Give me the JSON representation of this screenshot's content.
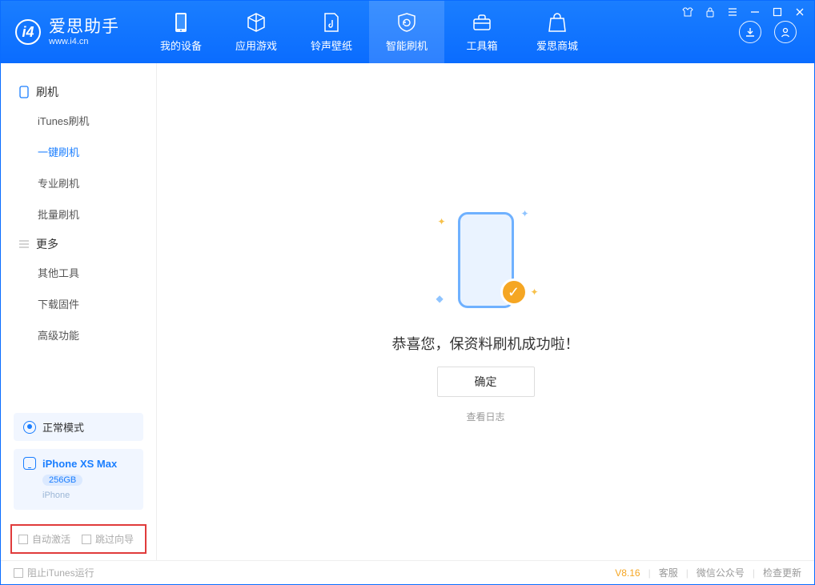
{
  "app": {
    "title": "爱思助手",
    "site": "www.i4.cn"
  },
  "nav": {
    "items": [
      {
        "label": "我的设备"
      },
      {
        "label": "应用游戏"
      },
      {
        "label": "铃声壁纸"
      },
      {
        "label": "智能刷机"
      },
      {
        "label": "工具箱"
      },
      {
        "label": "爱思商城"
      }
    ]
  },
  "sidebar": {
    "group1": {
      "title": "刷机",
      "items": [
        "iTunes刷机",
        "一键刷机",
        "专业刷机",
        "批量刷机"
      ]
    },
    "group2": {
      "title": "更多",
      "items": [
        "其他工具",
        "下载固件",
        "高级功能"
      ]
    }
  },
  "mode": {
    "label": "正常模式"
  },
  "device": {
    "name": "iPhone XS Max",
    "capacity": "256GB",
    "type": "iPhone"
  },
  "options": {
    "auto_activate": "自动激活",
    "skip_guide": "跳过向导"
  },
  "main": {
    "success": "恭喜您，保资料刷机成功啦！",
    "ok": "确定",
    "view_log": "查看日志"
  },
  "footer": {
    "block_itunes": "阻止iTunes运行",
    "version": "V8.16",
    "links": [
      "客服",
      "微信公众号",
      "检查更新"
    ]
  }
}
